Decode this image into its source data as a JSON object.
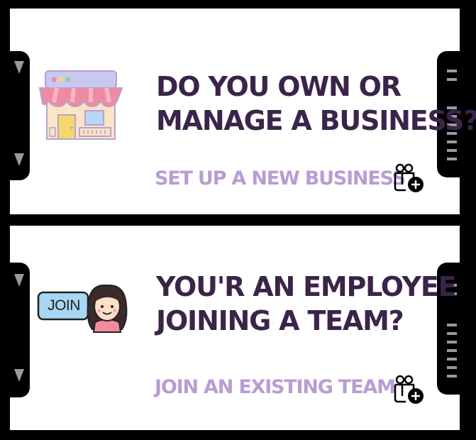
{
  "colors": {
    "headline": "#3b2449",
    "action": "#b89dd2",
    "frame": "#000000",
    "card": "#ffffff"
  },
  "owner_card": {
    "title_line1": "DO YOU OWN OR",
    "title_line2": "MANAGE A BUSINESS?",
    "action_label": "SET UP A NEW BUSINESS",
    "illustration": "storefront-icon",
    "action_icon": "add-team-icon"
  },
  "employee_card": {
    "title_line1": "YOU'R AN EMPLOYEE",
    "title_line2": "JOINING A TEAM?",
    "action_label": "JOIN AN EXISTING TEAM",
    "badge_text": "JOIN",
    "illustration": "join-avatar-icon",
    "action_icon": "add-team-icon"
  }
}
